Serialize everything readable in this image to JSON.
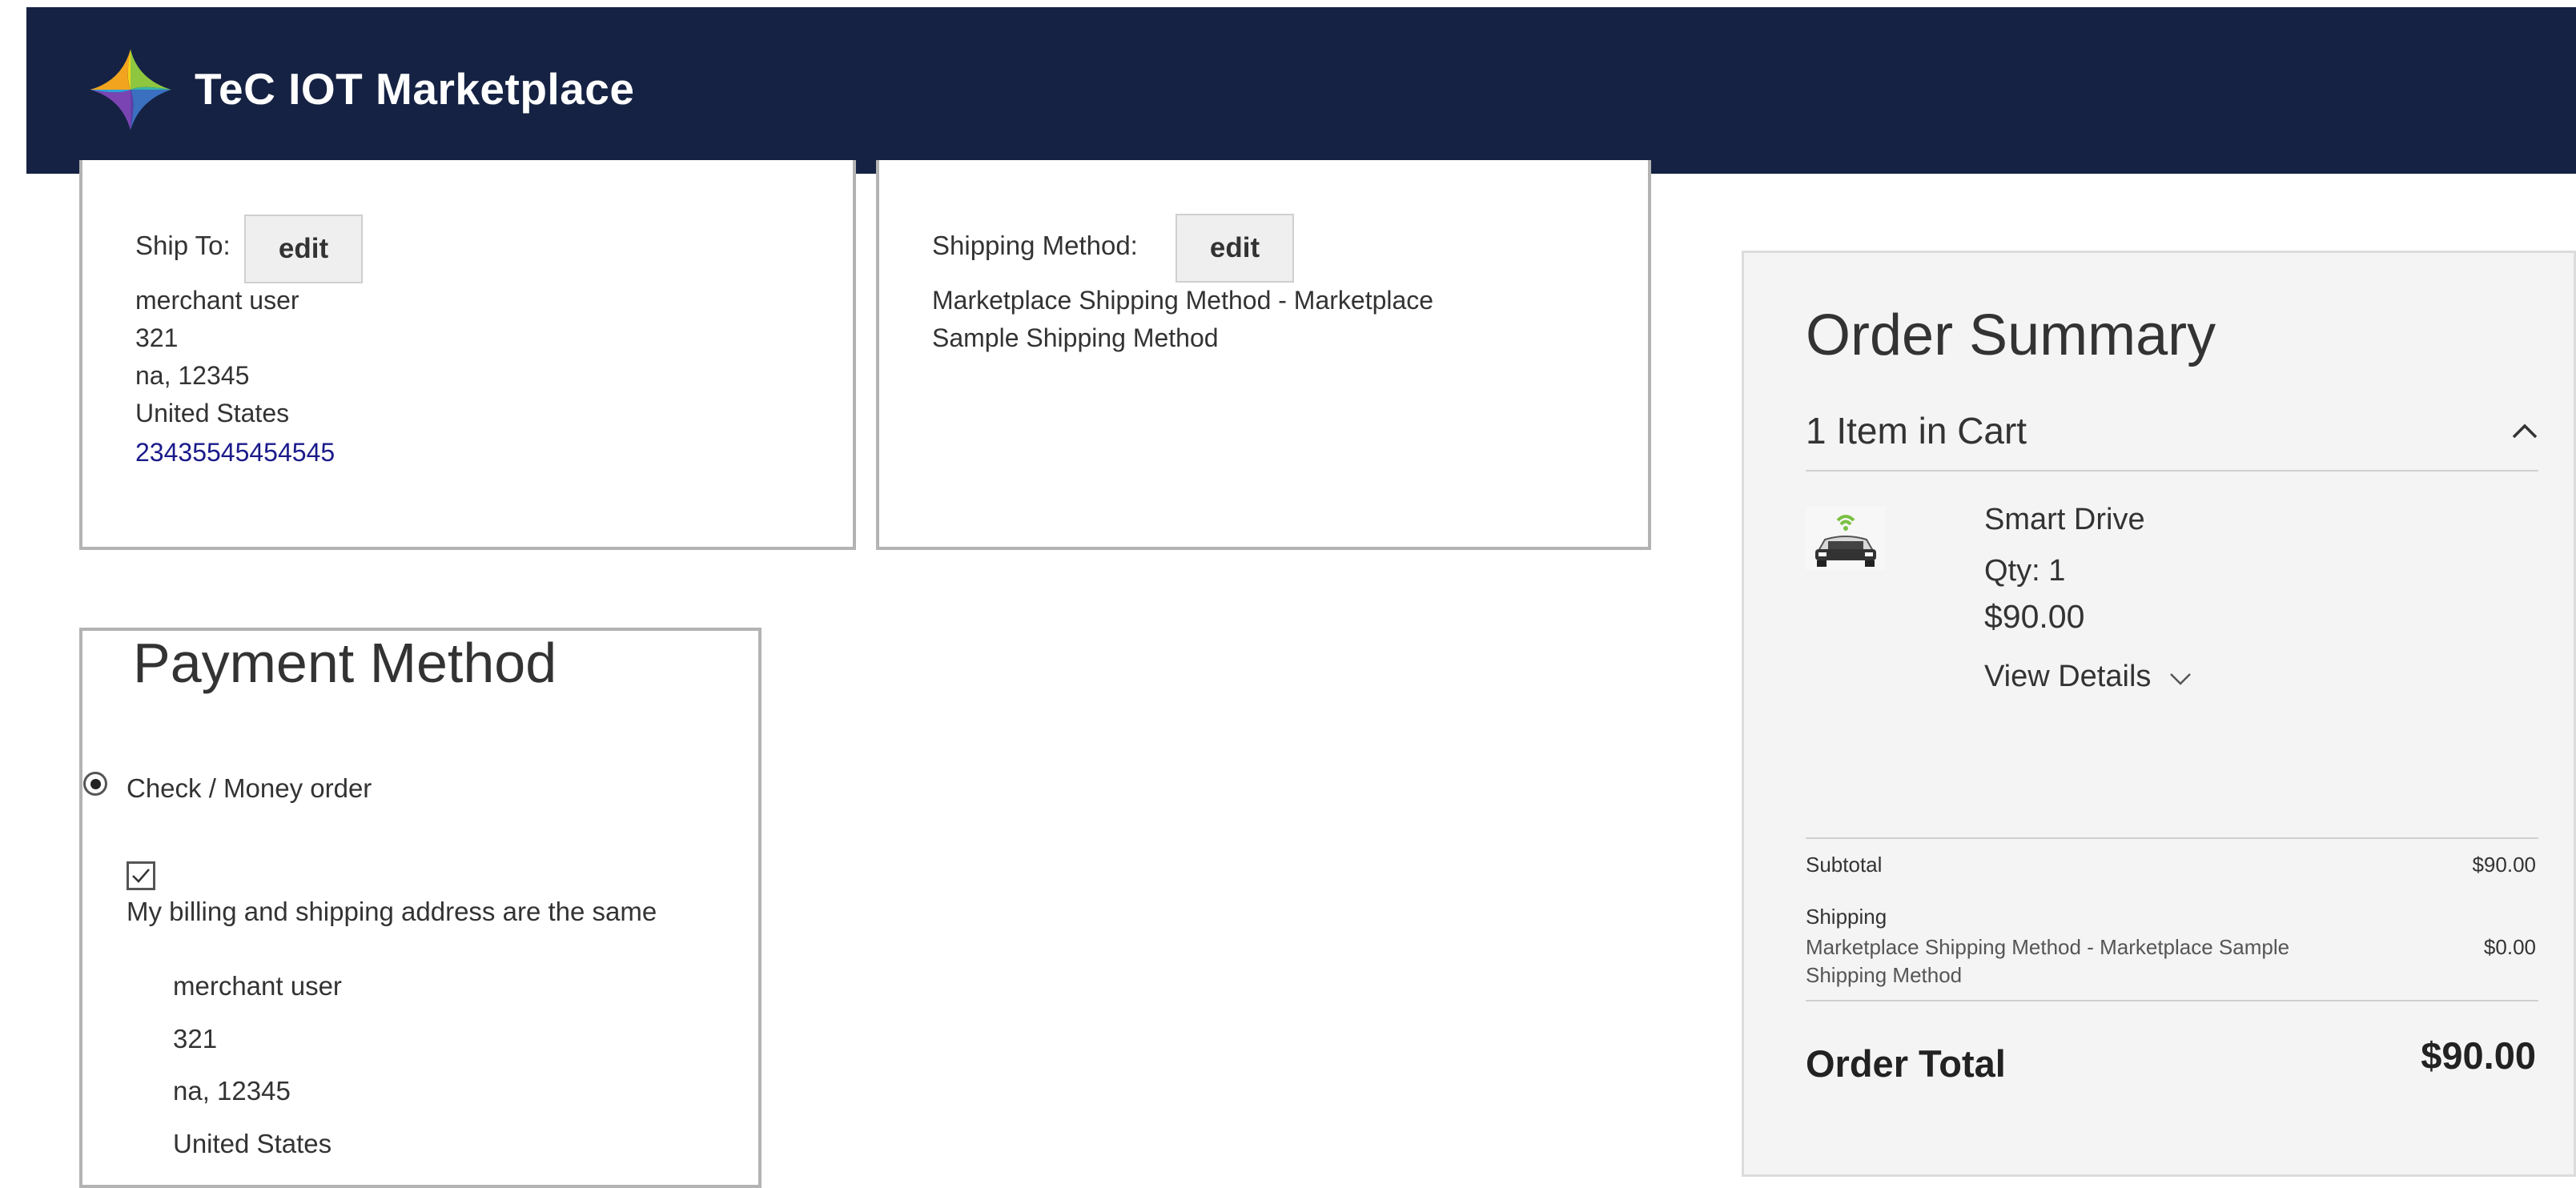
{
  "header": {
    "brand": "TeC IOT Marketplace",
    "bg_color": "#152243"
  },
  "ship_to": {
    "label": "Ship To:",
    "edit_label": "edit",
    "name": "merchant user",
    "street": "321",
    "city_zip": "na, 12345",
    "country": "United States",
    "phone": "23435545454545"
  },
  "shipping_method": {
    "label": "Shipping Method:",
    "edit_label": "edit",
    "line1": "Marketplace Shipping Method - Marketplace",
    "line2": "Sample Shipping Method"
  },
  "payment": {
    "title": "Payment Method",
    "option_label": "Check / Money order",
    "same_address_label": "My billing and shipping address are the same",
    "name": "merchant user",
    "street": "321",
    "city_zip": "na, 12345",
    "country": "United States"
  },
  "summary": {
    "title": "Order Summary",
    "cart_count": "1 Item in Cart",
    "item": {
      "name": "Smart Drive",
      "qty": "Qty: 1",
      "price": "$90.00",
      "details": "View Details",
      "image_icon": "smart-car-icon"
    },
    "subtotal_label": "Subtotal",
    "subtotal_value": "$90.00",
    "shipping_label": "Shipping",
    "shipping_line1": "Marketplace Shipping Method - Marketplace Sample",
    "shipping_line2": "Shipping Method",
    "shipping_value": "$0.00",
    "total_label": "Order Total",
    "total_value": "$90.00"
  }
}
